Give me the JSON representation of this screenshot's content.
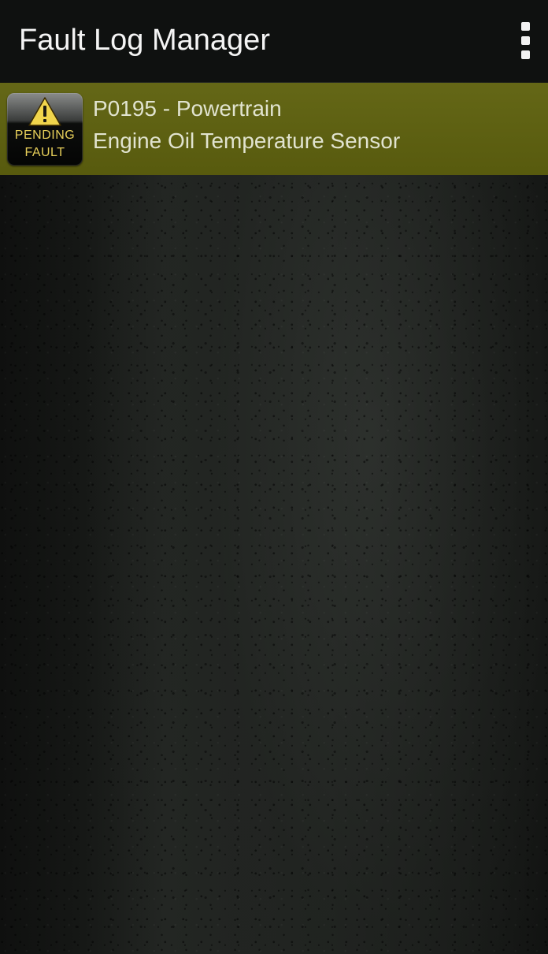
{
  "app_bar": {
    "title": "Fault Log Manager",
    "overflow_icon": "more-vertical-icon"
  },
  "faults": [
    {
      "code_line": "P0195 - Powertrain",
      "description": "Engine Oil Temperature Sensor",
      "badge": {
        "icon": "warning-triangle-icon",
        "line1": "PENDING",
        "line2": "FAULT"
      }
    }
  ],
  "colors": {
    "app_bar_bg": "#0f1110",
    "fault_row_bg": "#5f620f",
    "badge_text": "#e8d05a",
    "warning_triangle": "#f1d54c",
    "text_primary": "#f4f4f4",
    "text_row": "#e1e3cf"
  }
}
